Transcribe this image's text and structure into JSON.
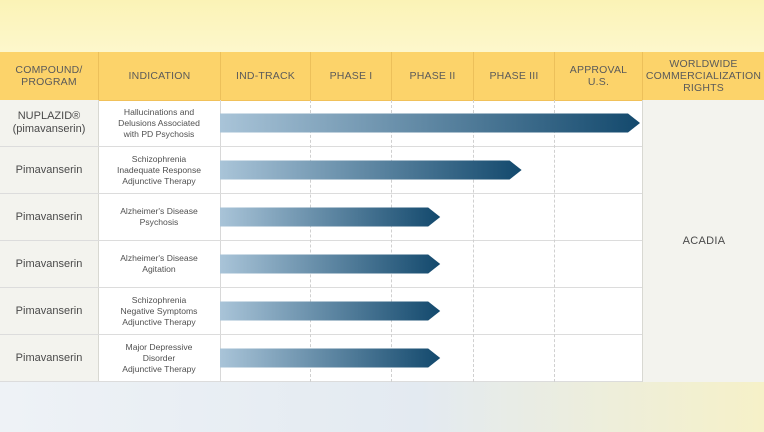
{
  "chart_data": {
    "type": "bar",
    "orientation": "horizontal",
    "columns": [
      "COMPOUND/\nPROGRAM",
      "INDICATION",
      "IND-TRACK",
      "PHASE I",
      "PHASE II",
      "PHASE III",
      "APPROVAL\nU.S.",
      "WORLDWIDE\nCOMMERCIALIZATION\nRIGHTS"
    ],
    "stages": [
      "IND-TRACK",
      "PHASE I",
      "PHASE II",
      "PHASE III",
      "APPROVAL U.S."
    ],
    "rows": [
      {
        "compound": "NUPLAZID®\n(pimavanserin)",
        "indication": "Hallucinations and\nDelusions Associated\nwith PD Psychosis",
        "progress": 5.0
      },
      {
        "compound": "Pimavanserin",
        "indication": "Schizophrenia\nInadequate Response\nAdjunctive Therapy",
        "progress": 3.6
      },
      {
        "compound": "Pimavanserin",
        "indication": "Alzheimer's Disease\nPsychosis",
        "progress": 2.6
      },
      {
        "compound": "Pimavanserin",
        "indication": "Alzheimer's Disease\nAgitation",
        "progress": 2.6
      },
      {
        "compound": "Pimavanserin",
        "indication": "Schizophrenia\nNegative Symptoms\nAdjunctive Therapy",
        "progress": 2.6
      },
      {
        "compound": "Pimavanserin",
        "indication": "Major Depressive\nDisorder\nAdjunctive Therapy",
        "progress": 2.6
      }
    ],
    "rights": "ACADIA",
    "colors": {
      "header": "#fcd36a",
      "bar_start": "#a9c4d8",
      "bar_end": "#13496d"
    }
  }
}
